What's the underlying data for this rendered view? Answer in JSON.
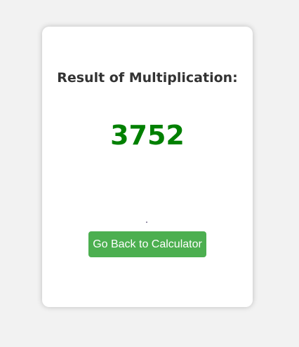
{
  "card": {
    "heading": "Result of Multiplication:",
    "result": "3752",
    "back_button_label": "Go Back to Calculator"
  },
  "colors": {
    "result": "#008000",
    "button": "#4caf50",
    "background": "#f2f2f2"
  }
}
